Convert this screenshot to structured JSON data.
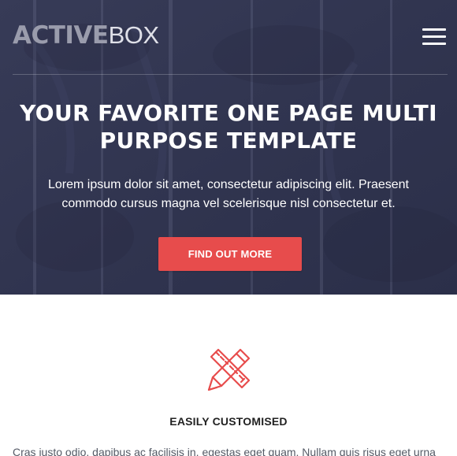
{
  "brand": {
    "name_strong": "ACTIVE",
    "name_light": "BOX"
  },
  "hero": {
    "title": "YOUR FAVORITE ONE PAGE MULTI PURPOSE TEMPLATE",
    "text": "Lorem ipsum dolor sit amet, consectetur adipiscing elit. Praesent commodo cursus magna vel scelerisque nisl consectetur et.",
    "cta_label": "FIND OUT MORE"
  },
  "features": [
    {
      "icon": "pencil-ruler-icon",
      "title": "EASILY CUSTOMISED",
      "text": "Cras justo odio, dapibus ac facilisis in, egestas eget quam. Nullam quis risus eget urna"
    }
  ],
  "colors": {
    "hero_bg": "#30344f",
    "accent": "#e74c4c",
    "text_white": "#ffffff",
    "heading_dark": "#222222"
  }
}
